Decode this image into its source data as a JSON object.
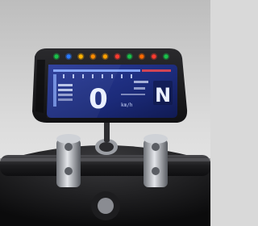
{
  "photo": {
    "subject": "motorcycle-lcd-instrument-cluster",
    "colors": {
      "background_top": "#cfcfcf",
      "background_bottom": "#e6e6e6",
      "bezel": "#1c1c1e",
      "lcd_background": "#1a2a7a",
      "lcd_digit": "#e8eefc",
      "handlebar": "#2a2a2c",
      "chrome": "#b9bcc2"
    }
  },
  "cluster": {
    "indicators": [
      {
        "name": "turn-left-indicator-icon",
        "color": "#19c24a"
      },
      {
        "name": "high-beam-indicator-icon",
        "color": "#2a7bff"
      },
      {
        "name": "fuel-indicator-icon",
        "color": "#ffb300"
      },
      {
        "name": "abs-indicator-icon",
        "color": "#ff8c00"
      },
      {
        "name": "engine-check-indicator-icon",
        "color": "#ffa000"
      },
      {
        "name": "oil-indicator-icon",
        "color": "#ff3b2f"
      },
      {
        "name": "neutral-indicator-icon",
        "color": "#19c24a"
      },
      {
        "name": "temperature-indicator-icon",
        "color": "#ff6a00"
      },
      {
        "name": "side-stand-indicator-icon",
        "color": "#ff3b2f"
      },
      {
        "name": "turn-right-indicator-icon",
        "color": "#19c24a"
      }
    ],
    "lcd": {
      "speed": "0",
      "speed_unit": "km/h",
      "gear": "N"
    }
  }
}
